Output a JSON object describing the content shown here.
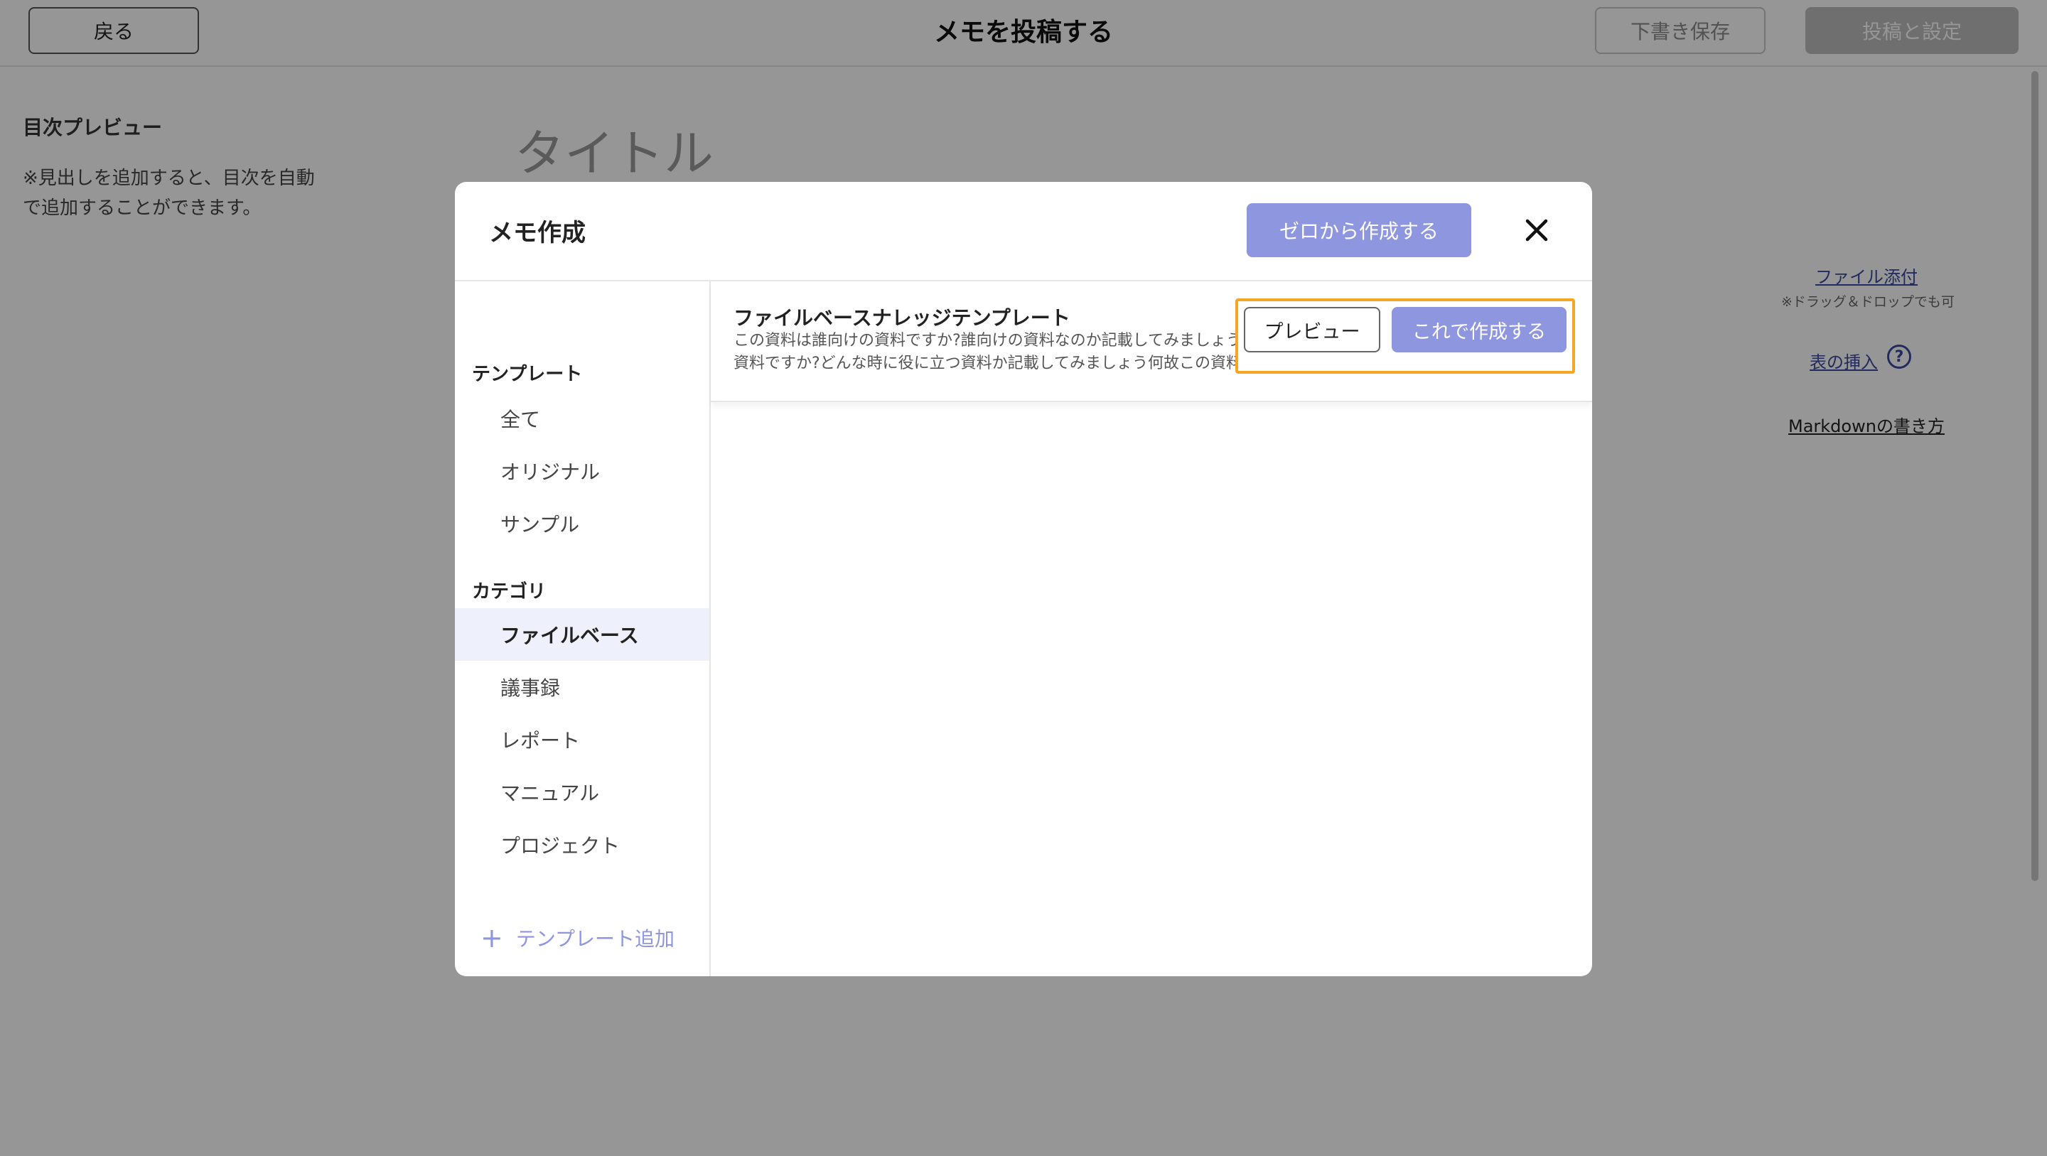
{
  "header": {
    "back_label": "戻る",
    "title": "メモを投稿する",
    "draft_label": "下書き保存",
    "post_label": "投稿と設定"
  },
  "toc": {
    "title": "目次プレビュー",
    "note": "※見出しを追加すると、目次を自動で追加することができます。"
  },
  "editor": {
    "title_placeholder": "タイトル"
  },
  "side_links": {
    "file_attach": "ファイル添付",
    "drag_note": "※ドラッグ＆ドロップでも可",
    "table_insert": "表の挿入",
    "help_icon": "?",
    "markdown_howto": "Markdownの書き方"
  },
  "modal": {
    "title": "メモ作成",
    "from_scratch_label": "ゼロから作成する",
    "close_icon": "close-icon",
    "sidebar": {
      "template_section": "テンプレート",
      "template_items": [
        "全て",
        "オリジナル",
        "サンプル"
      ],
      "category_section": "カテゴリ",
      "category_items": [
        "ファイルベース",
        "議事録",
        "レポート",
        "マニュアル",
        "プロジェクト"
      ],
      "active_item": "ファイルベース",
      "add_template_label": "テンプレート追加",
      "add_template_icon": "plus-icon"
    },
    "template": {
      "name": "ファイルベースナレッジテンプレート",
      "desc_line1": "この資料は誰向けの資料ですか?誰向けの資料なのか記載してみましょう",
      "desc_line2": "資料ですか?どんな時に役に立つ資料か記載してみましょう何故この資料が大切だと思います",
      "preview_label": "プレビュー",
      "create_label": "これで作成する"
    }
  },
  "colors": {
    "accent": "#8f96e0",
    "focus_outline": "#f5a623",
    "link": "#3c4aa0"
  }
}
